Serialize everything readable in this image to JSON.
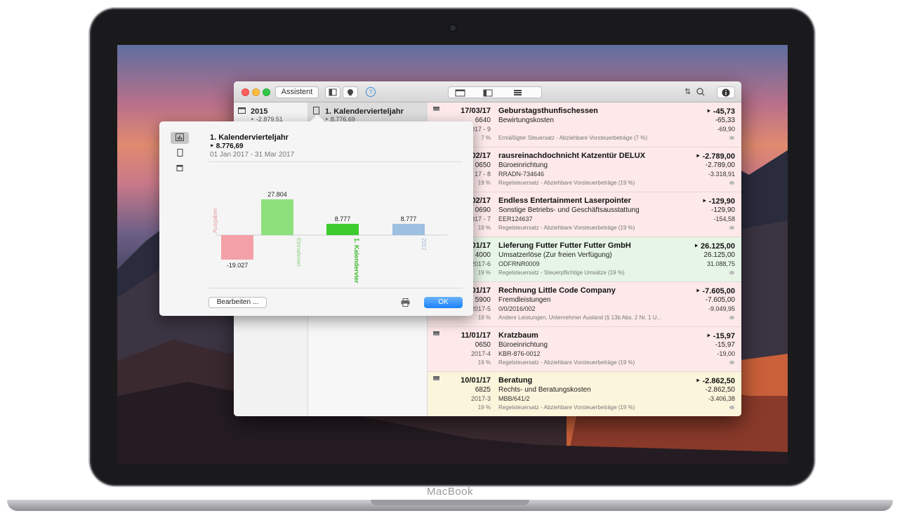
{
  "device": {
    "label": "MacBook"
  },
  "window": {
    "toolbar": {
      "assistant_label": "Assistent"
    },
    "col1": {
      "year": "2015",
      "amount": "-2.879,51"
    },
    "col2": {
      "period": "1. Kalendervierteljahr",
      "amount": "8.776,69"
    },
    "rows": [
      {
        "color": "#fde9ea",
        "date": "17/03/17",
        "account": "6640",
        "doc": "2017 - 9",
        "pct": "7 %",
        "title": "Geburstagsthunfischessen",
        "category": "Bewirtungskosten",
        "ref": "",
        "tax": "Ermäßigter Steuersatz - Abziehbare Vorsteuerbeträge (7 %)",
        "amount": "-45,73",
        "amount2": "-65,33",
        "amount3": "-69,90"
      },
      {
        "color": "#fde9ea",
        "date": "02/17",
        "account": "0650",
        "doc": "17 - 8",
        "pct": "19 %",
        "title": "rausreinachdochnicht Katzentür DELUX",
        "category": "Büroeinrichtung",
        "ref": "RRADN-734646",
        "tax": "Regelsteuersatz - Abziehbare Vorsteuerbeträge (19 %)",
        "amount": "-2.789,00",
        "amount2": "-2.789,00",
        "amount3": "-3.318,91"
      },
      {
        "color": "#fde9ea",
        "date": "02/17",
        "account": "0690",
        "doc": "017 - 7",
        "pct": "19 %",
        "title": "Endless Entertainment Laserpointer",
        "category": "Sonstige Betriebs- und Geschäftsausstattung",
        "ref": "EER124637",
        "tax": "Regelsteuersatz - Abziehbare Vorsteuerbeträge (19 %)",
        "amount": "-129,90",
        "amount2": "-129,90",
        "amount3": "-154,58"
      },
      {
        "color": "#e6f5e6",
        "date": "01/17",
        "account": "4000",
        "doc": "2017-6",
        "pct": "19 %",
        "title": "Lieferung Futter Futter Futter GmbH",
        "category": "Umsatzerlöse (Zur freien Verfügung)",
        "ref": "ODFRNR0009",
        "tax": "Regelsteuersatz - Steuerpflichtige Umsätze (19 %)",
        "amount": "26.125,00",
        "amount2": "26.125,00",
        "amount3": "31.088,75"
      },
      {
        "color": "#fde9ea",
        "date": "01/17",
        "account": "5900",
        "doc": "2017-5",
        "pct": "19 %",
        "title": "Rechnung Little Code Company",
        "category": "Fremdleistungen",
        "ref": "0/0/2016/002",
        "tax": "Andere Leistungen, Unternehmer Ausland (§ 13b Abs. 2 Nr. 1 U...",
        "amount": "-7.605,00",
        "amount2": "-7.605,00",
        "amount3": "-9.049,95"
      },
      {
        "color": "#fde9ea",
        "date": "11/01/17",
        "account": "0650",
        "doc": "2017-4",
        "pct": "19 %",
        "title": "Kratzbaum",
        "category": "Büroeinrichtung",
        "ref": "KBR-876-0012",
        "tax": "Regelsteuersatz - Abziehbare Vorsteuerbeträge (19 %)",
        "amount": "-15,97",
        "amount2": "-15,97",
        "amount3": "-19,00"
      },
      {
        "color": "#fbf5dc",
        "date": "10/01/17",
        "account": "6825",
        "doc": "2017-3",
        "pct": "19 %",
        "title": "Beratung",
        "category": "Rechts- und Beratungskosten",
        "ref": "MBB/641/2",
        "tax": "Regelsteuersatz - Abziehbare Vorsteuerbeträge (19 %)",
        "amount": "-2.862,50",
        "amount2": "-2.862,50",
        "amount3": "-3.406,38"
      }
    ]
  },
  "popover": {
    "title": "1. Kalendervierteljahr",
    "amount": "8.776,69",
    "range": "01 Jan 2017 - 31 Mar 2017",
    "edit_label": "Bearbeiten ...",
    "ok_label": "OK"
  },
  "chart_data": {
    "type": "bar",
    "categories": [
      "Ausgaben",
      "Einnahmen",
      "1. Kalendervierteljahr",
      "2017"
    ],
    "category_labels": [
      "Ausgaben",
      "Einnahmen",
      "1. Kalendervier",
      "2017"
    ],
    "values": [
      -19.027,
      27.804,
      8.777,
      8.777
    ],
    "value_labels": [
      "-19.027",
      "27.804",
      "8.777",
      "8.777"
    ],
    "colors": [
      "#f4a0a8",
      "#8ee07c",
      "#3ecb2e",
      "#9dbfe0"
    ],
    "label_colors": [
      "#e79aa0",
      "#8ccf7c",
      "#3fb82f",
      "#9ab7d4"
    ],
    "ylim": [
      -30,
      30
    ]
  }
}
